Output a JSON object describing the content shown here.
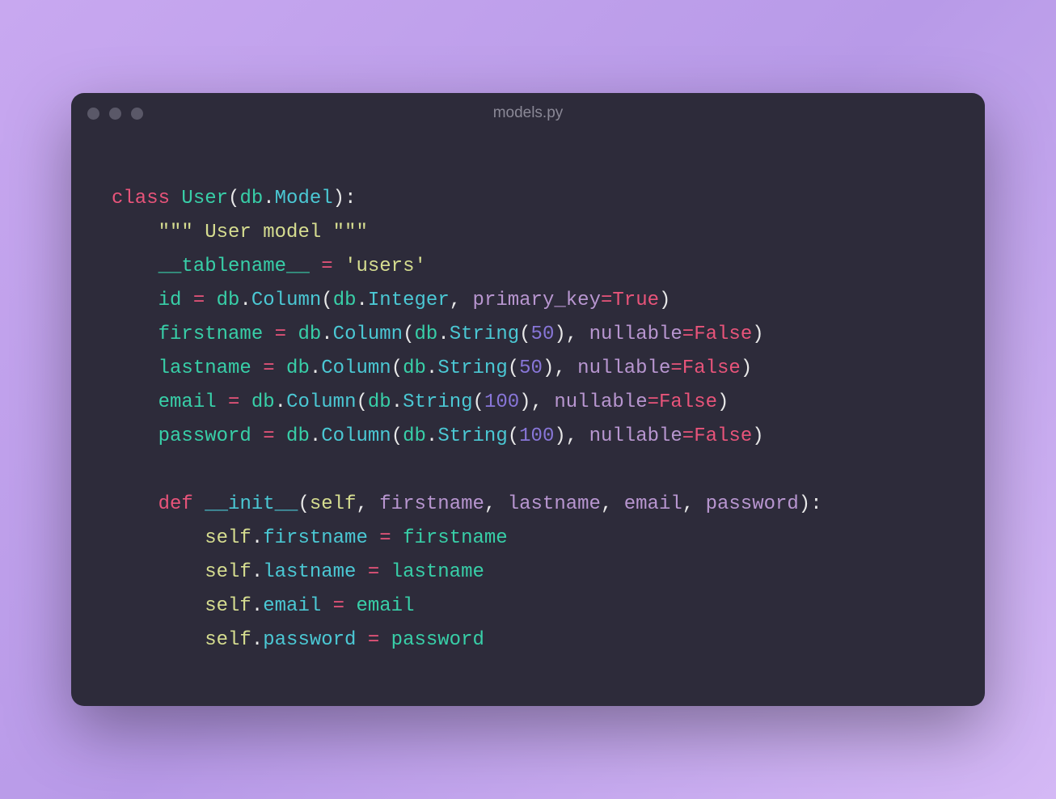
{
  "window": {
    "title": "models.py"
  },
  "code": {
    "line1": {
      "class_kw": "class",
      "class_name": "User",
      "lparen": "(",
      "db": "db",
      "dot": ".",
      "model": "Model",
      "rparen_colon": "):"
    },
    "line2": {
      "docstring": "\"\"\" User model \"\"\""
    },
    "line3": {
      "tablename": "__tablename__",
      "eq": " = ",
      "val": "'users'"
    },
    "line4": {
      "id": "id",
      "eq": " = ",
      "db1": "db",
      "dot1": ".",
      "col": "Column",
      "lp": "(",
      "db2": "db",
      "dot2": ".",
      "typ": "Integer",
      "comma": ", ",
      "pk": "primary_key",
      "eq2": "=",
      "true": "True",
      "rp": ")"
    },
    "line5": {
      "fn": "firstname",
      "eq": " = ",
      "db1": "db",
      "dot1": ".",
      "col": "Column",
      "lp": "(",
      "db2": "db",
      "dot2": ".",
      "str": "String",
      "lp2": "(",
      "num": "50",
      "rp2": ")",
      "comma": ", ",
      "nul": "nullable",
      "eq2": "=",
      "false": "False",
      "rp": ")"
    },
    "line6": {
      "ln": "lastname",
      "eq": " = ",
      "db1": "db",
      "dot1": ".",
      "col": "Column",
      "lp": "(",
      "db2": "db",
      "dot2": ".",
      "str": "String",
      "lp2": "(",
      "num": "50",
      "rp2": ")",
      "comma": ", ",
      "nul": "nullable",
      "eq2": "=",
      "false": "False",
      "rp": ")"
    },
    "line7": {
      "em": "email",
      "eq": " = ",
      "db1": "db",
      "dot1": ".",
      "col": "Column",
      "lp": "(",
      "db2": "db",
      "dot2": ".",
      "str": "String",
      "lp2": "(",
      "num": "100",
      "rp2": ")",
      "comma": ", ",
      "nul": "nullable",
      "eq2": "=",
      "false": "False",
      "rp": ")"
    },
    "line8": {
      "pw": "password",
      "eq": " = ",
      "db1": "db",
      "dot1": ".",
      "col": "Column",
      "lp": "(",
      "db2": "db",
      "dot2": ".",
      "str": "String",
      "lp2": "(",
      "num": "100",
      "rp2": ")",
      "comma": ", ",
      "nul": "nullable",
      "eq2": "=",
      "false": "False",
      "rp": ")"
    },
    "line10": {
      "def_kw": "def",
      "fname": "__init__",
      "lp": "(",
      "self": "self",
      "c1": ", ",
      "p1": "firstname",
      "c2": ", ",
      "p2": "lastname",
      "c3": ", ",
      "p3": "email",
      "c4": ", ",
      "p4": "password",
      "rp": "):"
    },
    "line11": {
      "self": "self",
      "dot": ".",
      "attr": "firstname",
      "eq": " = ",
      "val": "firstname"
    },
    "line12": {
      "self": "self",
      "dot": ".",
      "attr": "lastname",
      "eq": " = ",
      "val": "lastname"
    },
    "line13": {
      "self": "self",
      "dot": ".",
      "attr": "email",
      "eq": " = ",
      "val": "email"
    },
    "line14": {
      "self": "self",
      "dot": ".",
      "attr": "password",
      "eq": " = ",
      "val": "password"
    }
  }
}
